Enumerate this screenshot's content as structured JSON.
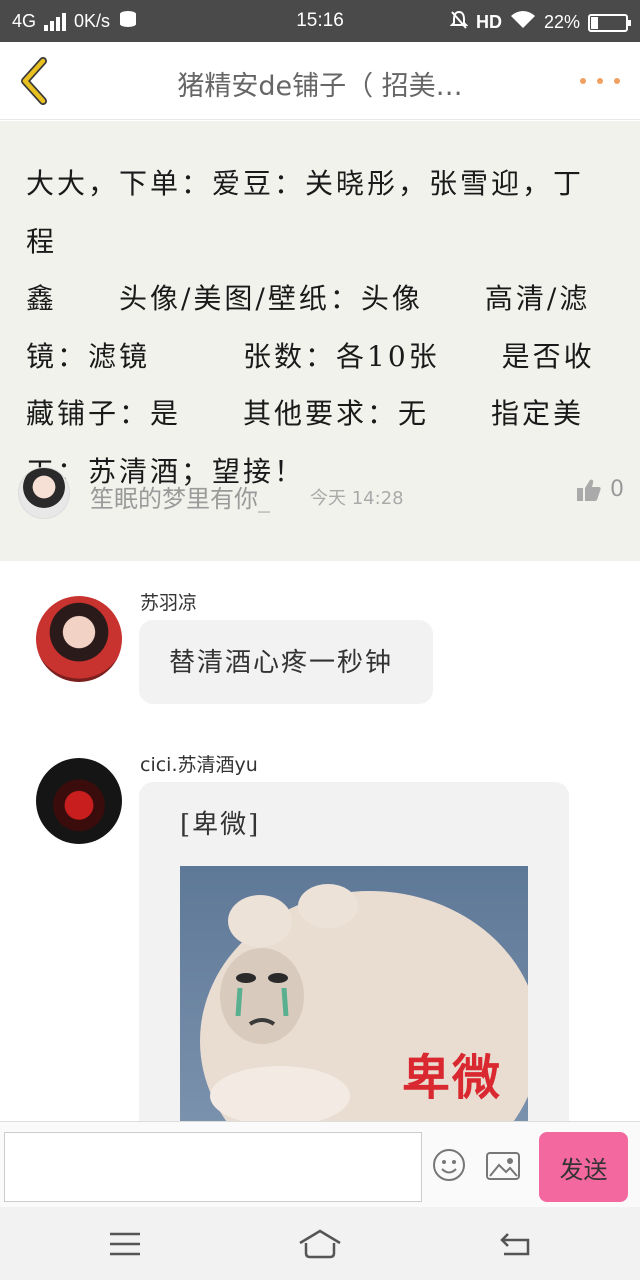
{
  "status_bar": {
    "network": "4G",
    "speed": "0K/s",
    "time": "15:16",
    "hd": "HD",
    "battery": "22%",
    "battery_level": 0.22
  },
  "header": {
    "title": "猪精安de铺子（ 招美…"
  },
  "post": {
    "lines": [
      "大大，下单：爱豆：关晓彤，张雪迎，丁程",
      "鑫　　头像/美图/壁纸：头像　　高清/滤",
      "镜：滤镜　　　张数：各10张　　是否收",
      "藏铺子：是　　其他要求：无　　指定美",
      "工：苏清酒；望接！"
    ],
    "author": "笙眠的梦里有你_",
    "time": "今天 14:28",
    "likes": "0"
  },
  "comments": [
    {
      "name": "苏羽凉",
      "text": "替清酒心疼一秒钟"
    },
    {
      "name": "cici.苏清酒yu",
      "text": "[卑微]",
      "sticker_caption": "卑微"
    }
  ],
  "input": {
    "placeholder": "",
    "send_label": "发送"
  },
  "colors": {
    "accent": "#f468a0",
    "back_arrow": "#e8c020",
    "more_dots": "#f0a060"
  }
}
